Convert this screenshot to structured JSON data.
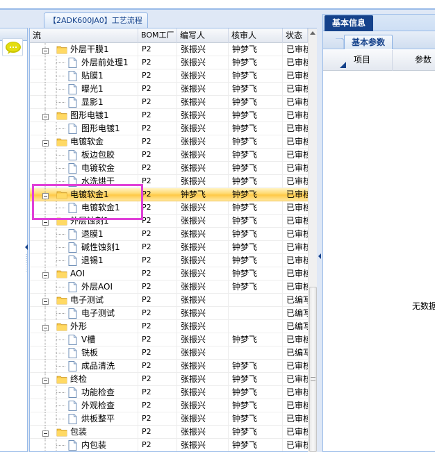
{
  "colors": {
    "accent": "#15428b",
    "border": "#99bbe8",
    "selected": "#ffd86b",
    "highlight_box": "#e040d8"
  },
  "workflow_tab": {
    "title": "【2ADK600JA0】工艺流程"
  },
  "grid": {
    "columns": [
      "流",
      "BOM工厂",
      "编写人",
      "核审人",
      "状态"
    ],
    "rows": [
      {
        "level": 1,
        "type": "folder",
        "name": "外层干膜1",
        "bom": "P2",
        "author": "张振兴",
        "reviewer": "钟梦飞",
        "status": "已审核"
      },
      {
        "level": 2,
        "type": "doc",
        "name": "外层前处理1",
        "bom": "P2",
        "author": "张振兴",
        "reviewer": "钟梦飞",
        "status": "已审核"
      },
      {
        "level": 2,
        "type": "doc",
        "name": "贴膜1",
        "bom": "P2",
        "author": "张振兴",
        "reviewer": "钟梦飞",
        "status": "已审核"
      },
      {
        "level": 2,
        "type": "doc",
        "name": "曝光1",
        "bom": "P2",
        "author": "张振兴",
        "reviewer": "钟梦飞",
        "status": "已审核"
      },
      {
        "level": 2,
        "type": "doc",
        "name": "显影1",
        "bom": "P2",
        "author": "张振兴",
        "reviewer": "钟梦飞",
        "status": "已审核"
      },
      {
        "level": 1,
        "type": "folder",
        "name": "图形电镀1",
        "bom": "P2",
        "author": "张振兴",
        "reviewer": "钟梦飞",
        "status": "已审核"
      },
      {
        "level": 2,
        "type": "doc",
        "name": "图形电镀1",
        "bom": "P2",
        "author": "张振兴",
        "reviewer": "钟梦飞",
        "status": "已审核"
      },
      {
        "level": 1,
        "type": "folder",
        "name": "电镀软金",
        "bom": "P2",
        "author": "张振兴",
        "reviewer": "钟梦飞",
        "status": "已审核"
      },
      {
        "level": 2,
        "type": "doc",
        "name": "板边包胶",
        "bom": "P2",
        "author": "张振兴",
        "reviewer": "钟梦飞",
        "status": "已审核"
      },
      {
        "level": 2,
        "type": "doc",
        "name": "电镀软金",
        "bom": "P2",
        "author": "张振兴",
        "reviewer": "钟梦飞",
        "status": "已审核"
      },
      {
        "level": 2,
        "type": "doc",
        "name": "水洗烘干",
        "bom": "P2",
        "author": "张振兴",
        "reviewer": "钟梦飞",
        "status": "已审核"
      },
      {
        "level": 1,
        "type": "folder",
        "name": "电镀软金1",
        "bom": "P2",
        "author": "钟梦飞",
        "reviewer": "钟梦飞",
        "status": "已审核",
        "selected": true
      },
      {
        "level": 2,
        "type": "doc",
        "name": "电镀软金1",
        "bom": "P2",
        "author": "张振兴",
        "reviewer": "钟梦飞",
        "status": "已审核"
      },
      {
        "level": 1,
        "type": "folder",
        "name": "外层蚀刻1",
        "bom": "P2",
        "author": "张振兴",
        "reviewer": "钟梦飞",
        "status": "已审核"
      },
      {
        "level": 2,
        "type": "doc",
        "name": "退膜1",
        "bom": "P2",
        "author": "张振兴",
        "reviewer": "钟梦飞",
        "status": "已审核"
      },
      {
        "level": 2,
        "type": "doc",
        "name": "碱性蚀刻1",
        "bom": "P2",
        "author": "张振兴",
        "reviewer": "钟梦飞",
        "status": "已审核"
      },
      {
        "level": 2,
        "type": "doc",
        "name": "退锡1",
        "bom": "P2",
        "author": "张振兴",
        "reviewer": "钟梦飞",
        "status": "已审核"
      },
      {
        "level": 1,
        "type": "folder",
        "name": "AOI",
        "bom": "P2",
        "author": "张振兴",
        "reviewer": "钟梦飞",
        "status": "已审核"
      },
      {
        "level": 2,
        "type": "doc",
        "name": "外层AOI",
        "bom": "P2",
        "author": "张振兴",
        "reviewer": "钟梦飞",
        "status": "已审核"
      },
      {
        "level": 1,
        "type": "folder",
        "name": "电子测试",
        "bom": "P2",
        "author": "张振兴",
        "reviewer": "",
        "status": "已编写"
      },
      {
        "level": 2,
        "type": "doc",
        "name": "电子测试",
        "bom": "P2",
        "author": "张振兴",
        "reviewer": "",
        "status": "已编写"
      },
      {
        "level": 1,
        "type": "folder",
        "name": "外形",
        "bom": "P2",
        "author": "张振兴",
        "reviewer": "",
        "status": "已编写"
      },
      {
        "level": 2,
        "type": "doc",
        "name": "V槽",
        "bom": "P2",
        "author": "张振兴",
        "reviewer": "钟梦飞",
        "status": "已审核"
      },
      {
        "level": 2,
        "type": "doc",
        "name": "铣板",
        "bom": "P2",
        "author": "张振兴",
        "reviewer": "",
        "status": "已编写"
      },
      {
        "level": 2,
        "type": "doc",
        "name": "成品清洗",
        "bom": "P2",
        "author": "张振兴",
        "reviewer": "钟梦飞",
        "status": "已审核"
      },
      {
        "level": 1,
        "type": "folder",
        "name": "终检",
        "bom": "P2",
        "author": "张振兴",
        "reviewer": "钟梦飞",
        "status": "已审核"
      },
      {
        "level": 2,
        "type": "doc",
        "name": "功能检查",
        "bom": "P2",
        "author": "张振兴",
        "reviewer": "钟梦飞",
        "status": "已审核"
      },
      {
        "level": 2,
        "type": "doc",
        "name": "外观检查",
        "bom": "P2",
        "author": "张振兴",
        "reviewer": "钟梦飞",
        "status": "已审核"
      },
      {
        "level": 2,
        "type": "doc",
        "name": "烘板整平",
        "bom": "P2",
        "author": "张振兴",
        "reviewer": "钟梦飞",
        "status": "已审核"
      },
      {
        "level": 1,
        "type": "folder",
        "name": "包装",
        "bom": "P2",
        "author": "张振兴",
        "reviewer": "钟梦飞",
        "status": "已审核"
      },
      {
        "level": 2,
        "type": "doc",
        "name": "内包装",
        "bom": "P2",
        "author": "张振兴",
        "reviewer": "钟梦飞",
        "status": "已审核"
      }
    ]
  },
  "right_panel": {
    "tab": "基本信息",
    "subtab": "基本参数",
    "columns": [
      "项目",
      "参数"
    ],
    "empty_text": "无数据"
  },
  "icons": [
    "chat-bubble-icon",
    "folder-icon",
    "document-icon",
    "tree-expand-icon",
    "sort-arrow-icon",
    "splitter-collapse-icon"
  ]
}
